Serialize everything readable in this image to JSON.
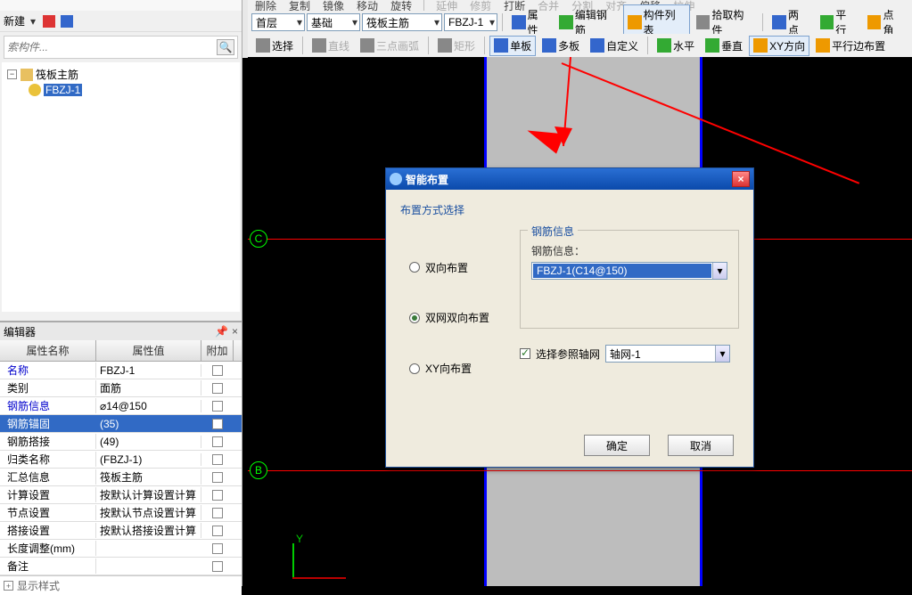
{
  "toolbar1": {
    "delete": "删除",
    "copy": "复制",
    "mirror": "镜像",
    "move": "移动",
    "rotate": "旋转",
    "t1": "延伸",
    "t2": "修剪",
    "t3": "打断",
    "t4": "合并",
    "t5": "分割",
    "t6": "对齐",
    "t7": "偏移",
    "t8": "拉伸"
  },
  "toolbar2": {
    "floor": "首层",
    "basic": "基础",
    "rebar": "筏板主筋",
    "code": "FBZJ-1",
    "attr": "属性",
    "edit": "编辑钢筋",
    "list": "构件列表",
    "pick": "拾取构件",
    "two": "两点",
    "para": "平行",
    "corner": "点角"
  },
  "toolbar3": {
    "select": "选择",
    "line": "直线",
    "arc": "三点画弧",
    "rect": "矩形",
    "single": "单板",
    "multi": "多板",
    "custom": "自定义",
    "horiz": "水平",
    "vert": "垂直",
    "xy": "XY方向",
    "paraedge": "平行边布置"
  },
  "leftTop": {
    "new": "新建",
    "searchPlaceholder": "索构件...",
    "root": "筏板主筋",
    "child": "FBZJ-1"
  },
  "propPanel": {
    "title": "编辑器",
    "head_name": "属性名称",
    "head_val": "属性值",
    "head_add": "附加",
    "rows": [
      {
        "n": "名称",
        "v": "FBZJ-1",
        "blue": true
      },
      {
        "n": "类别",
        "v": "面筋"
      },
      {
        "n": "钢筋信息",
        "v": "⌀14@150",
        "blue": true
      },
      {
        "n": "钢筋锚固",
        "v": "(35)",
        "sel": true,
        "blue": true
      },
      {
        "n": "钢筋搭接",
        "v": "(49)"
      },
      {
        "n": "归类名称",
        "v": "(FBZJ-1)"
      },
      {
        "n": "汇总信息",
        "v": "筏板主筋"
      },
      {
        "n": "计算设置",
        "v": "按默认计算设置计算"
      },
      {
        "n": "节点设置",
        "v": "按默认节点设置计算"
      },
      {
        "n": "搭接设置",
        "v": "按默认搭接设置计算"
      },
      {
        "n": "长度调整(mm)",
        "v": ""
      },
      {
        "n": "备注",
        "v": ""
      }
    ],
    "expand": "显示样式"
  },
  "canvas": {
    "nodeC": "C",
    "nodeB": "B",
    "axisY": "Y"
  },
  "dialog": {
    "title": "智能布置",
    "group": "布置方式选择",
    "opt1": "双向布置",
    "opt2": "双网双向布置",
    "opt3": "XY向布置",
    "fieldset": "钢筋信息",
    "info_label": "钢筋信息：",
    "info_value": "FBZJ-1(C14@150)",
    "checkbox": "选择参照轴网",
    "axis_value": "轴网-1",
    "ok": "确定",
    "cancel": "取消"
  }
}
